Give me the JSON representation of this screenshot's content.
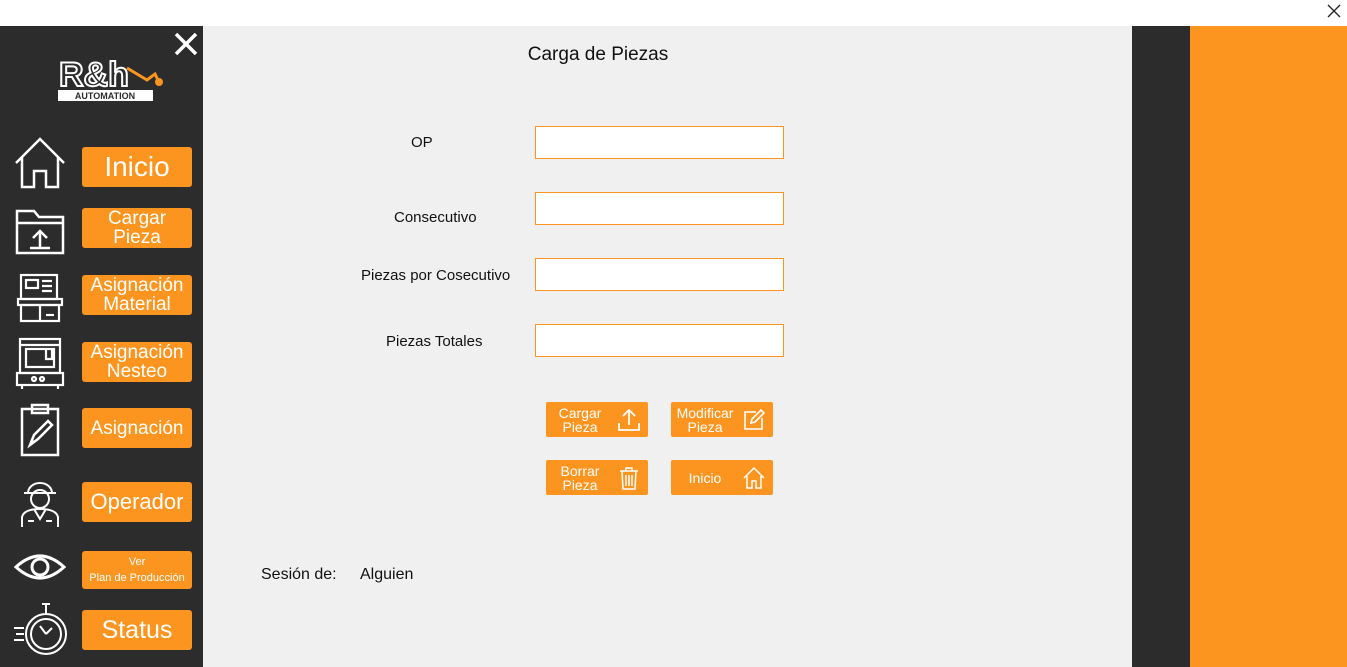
{
  "window": {
    "close_icon": "close-icon"
  },
  "sidebar": {
    "close_icon": "close-icon",
    "logo": {
      "main": "R&h",
      "sub": "AUTOMATION"
    },
    "nav": [
      {
        "id": "inicio",
        "icon": "home-icon",
        "lines": [
          "Inicio"
        ]
      },
      {
        "id": "cargar-pieza",
        "icon": "folder-upload-icon",
        "lines": [
          "Cargar",
          "Pieza"
        ]
      },
      {
        "id": "asignacion-material",
        "icon": "material-shelf-icon",
        "lines": [
          "Asignación",
          "Material"
        ]
      },
      {
        "id": "asignacion-nesteo",
        "icon": "machine-icon",
        "lines": [
          "Asignación",
          "Nesteo"
        ]
      },
      {
        "id": "asignacion",
        "icon": "clipboard-pen-icon",
        "lines": [
          "Asignación"
        ]
      },
      {
        "id": "operador",
        "icon": "worker-icon",
        "lines": [
          "Operador"
        ]
      },
      {
        "id": "ver-plan",
        "icon": "eye-icon",
        "lines": [
          "Ver",
          "Plan de Producción"
        ]
      },
      {
        "id": "status",
        "icon": "stopwatch-icon",
        "lines": [
          "Status"
        ]
      }
    ]
  },
  "main": {
    "title": "Carga de Piezas",
    "fields": [
      {
        "label": "OP",
        "value": ""
      },
      {
        "label": "Consecutivo",
        "value": ""
      },
      {
        "label": "Piezas por Cosecutivo",
        "value": ""
      },
      {
        "label": "Piezas Totales",
        "value": ""
      }
    ],
    "actions": [
      {
        "lines": [
          "Cargar",
          "Pieza"
        ],
        "icon": "upload-icon"
      },
      {
        "lines": [
          "Modificar",
          "Pieza"
        ],
        "icon": "edit-icon"
      },
      {
        "lines": [
          "Borrar",
          "Pieza"
        ],
        "icon": "trash-icon"
      },
      {
        "lines": [
          "Inicio"
        ],
        "icon": "home-icon"
      }
    ],
    "session": {
      "label": "Sesión de:",
      "user": "Alguien"
    }
  },
  "colors": {
    "accent": "#fc951f",
    "sidebar": "#2c2c2c",
    "main_bg": "#f0f0f0"
  }
}
